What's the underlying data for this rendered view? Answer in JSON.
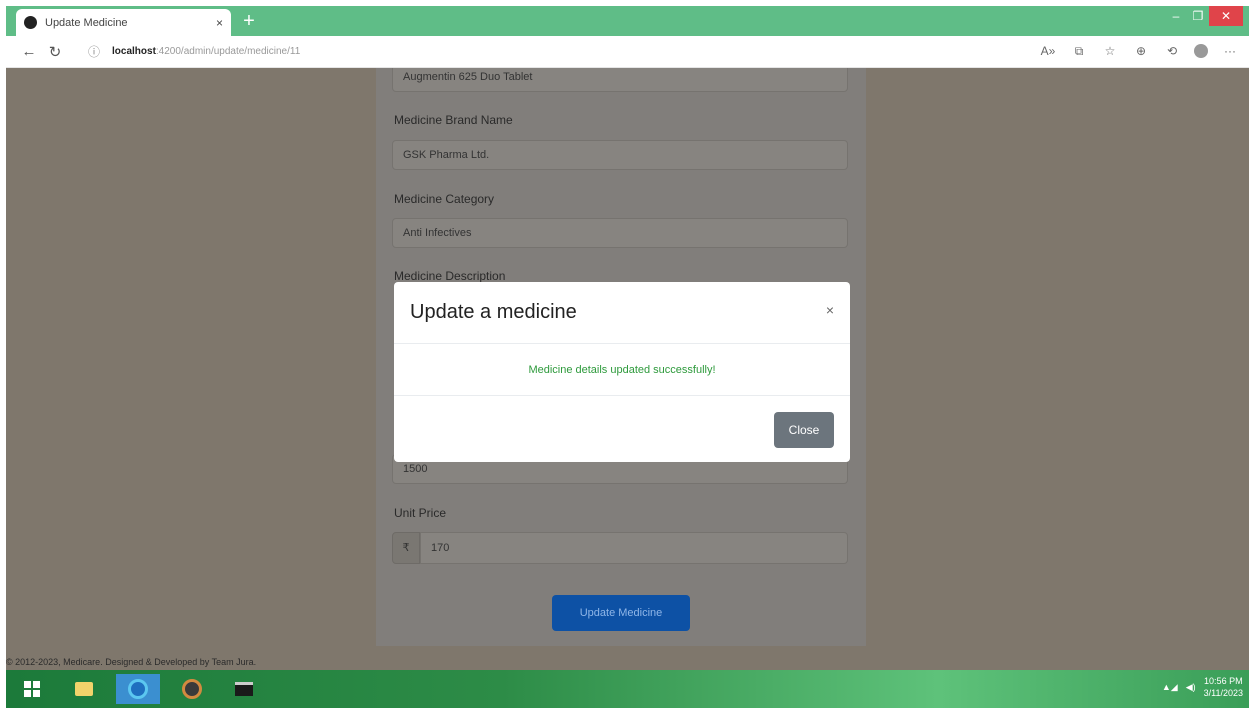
{
  "browser": {
    "tab_title": "Update Medicine",
    "tab_close": "×",
    "new_tab": "+",
    "window_controls": {
      "minimize": "–",
      "restore": "❐",
      "close": "✕"
    },
    "back_icon": "←",
    "refresh_icon": "↻",
    "info_icon": "ⓘ",
    "url_host": "localhost",
    "url_path": ":4200/admin/update/medicine/11",
    "toolbar_icons": [
      "read-aloud-icon",
      "extensions-icon",
      "favorites-icon",
      "collections-icon",
      "history-icon",
      "profile-icon",
      "more-icon"
    ],
    "toolbar_glyphs": [
      "A»",
      "⧉",
      "☆",
      "⊕",
      "⟲",
      "",
      "···"
    ]
  },
  "form": {
    "medicine_name_value": "Augmentin 625 Duo Tablet",
    "brand_label": "Medicine Brand Name",
    "brand_value": "GSK Pharma Ltd.",
    "category_label": "Medicine Category",
    "category_value": "Anti Infectives",
    "description_label": "Medicine Description",
    "stock_value": "1500",
    "unit_price_label": "Unit Price",
    "currency_symbol": "₹",
    "unit_price_value": "170",
    "submit_label": "Update Medicine"
  },
  "footer": {
    "text": "© 2012-2023, Medicare. Designed & Developed by Team Jura."
  },
  "modal": {
    "title": "Update a medicine",
    "close_x": "×",
    "message": "Medicine details updated successfully!",
    "close_button": "Close",
    "message_color": "#2e9a3c"
  },
  "taskbar": {
    "apps": [
      "windows-start-icon",
      "file-explorer-icon",
      "edge-icon",
      "app-icon",
      "command-prompt-icon"
    ],
    "time": "10:56 PM",
    "date": "3/11/2023"
  },
  "colors": {
    "tab_strip": "#5fbd87",
    "primary_button": "#0d6efd",
    "secondary_button": "#6c757d",
    "backdrop": "#7f776c"
  }
}
